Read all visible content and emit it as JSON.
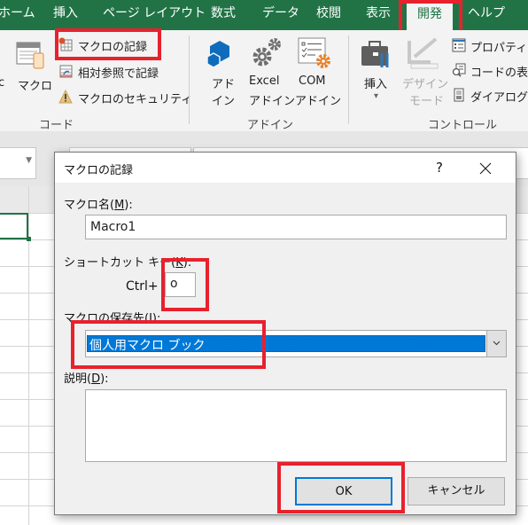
{
  "ribbon_tabs": [
    {
      "label": "ホーム",
      "active": false
    },
    {
      "label": "挿入",
      "active": false
    },
    {
      "label": "ページ レイアウト",
      "active": false
    },
    {
      "label": "数式",
      "active": false
    },
    {
      "label": "データ",
      "active": false
    },
    {
      "label": "校閲",
      "active": false
    },
    {
      "label": "表示",
      "active": false
    },
    {
      "label": "開発",
      "active": true
    },
    {
      "label": "ヘルプ",
      "active": false
    }
  ],
  "ribbon": {
    "code_group": {
      "partial_left_label": "c",
      "macro_button": "マクロ",
      "record_macro": "マクロの記録",
      "relative_ref": "相対参照で記録",
      "macro_security": "マクロのセキュリティ",
      "group_label": "コード"
    },
    "addin_group": {
      "addin_line1": "アド",
      "addin_line2": "イン",
      "excel_addin_line1": "Excel",
      "excel_addin_line2": "アドイン",
      "com_addin_line1": "COM",
      "com_addin_line2": "アドイン",
      "group_label": "アドイン"
    },
    "controls_group": {
      "insert": "挿入",
      "design_mode_line1": "デザイン",
      "design_mode_line2": "モード",
      "properties": "プロパティ",
      "view_code": "コードの表示",
      "run_dialog": "ダイアログの実行",
      "group_label": "コントロール"
    }
  },
  "dialog": {
    "title": "マクロの記録",
    "help_label": "?",
    "macro_name_label_pre": "マクロ名(",
    "macro_name_label_key": "M",
    "macro_name_label_post": "):",
    "macro_name_value": "Macro1",
    "shortcut_label_pre": "ショートカット キー(",
    "shortcut_label_key": "K",
    "shortcut_label_post": "):",
    "ctrl_label": "Ctrl+",
    "shortcut_value": "o",
    "store_label_pre": "マクロの保存先(",
    "store_label_key": "I",
    "store_label_post": "):",
    "store_selected": "個人用マクロ ブック",
    "description_label_pre": "説明(",
    "description_label_key": "D",
    "description_label_post": "):",
    "description_value": "",
    "ok_label": "OK",
    "cancel_label": "キャンセル"
  },
  "colors": {
    "ribbon_green": "#217346",
    "highlight_red": "#e8212d",
    "selection_blue": "#0078d7"
  }
}
